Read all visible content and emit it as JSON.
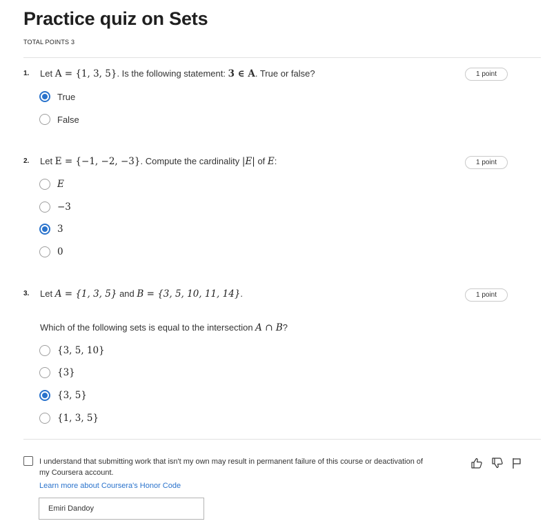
{
  "quiz": {
    "title": "Practice quiz on Sets",
    "total_points": "TOTAL POINTS 3"
  },
  "questions": [
    {
      "number": "1.",
      "points": "1 point",
      "prompt": {
        "t1": "Let ",
        "m1": "A = {1, 3, 5}",
        "t2": ". Is the following statement: ",
        "m2": "3 ∈ A",
        "t3": ". True or false?"
      },
      "options": [
        {
          "label": "True",
          "selected": true
        },
        {
          "label": "False",
          "selected": false
        }
      ]
    },
    {
      "number": "2.",
      "points": "1 point",
      "prompt": {
        "t1": "Let ",
        "m1": "E = {−1, −2, −3}",
        "t2": ". Compute the cardinality ",
        "m2": "|E|",
        "t3": " of ",
        "m3": "E",
        "t4": ":"
      },
      "options": [
        {
          "label": "E",
          "selected": false
        },
        {
          "label": "−3",
          "selected": false
        },
        {
          "label": "3",
          "selected": true
        },
        {
          "label": "0",
          "selected": false
        }
      ]
    },
    {
      "number": "3.",
      "points": "1 point",
      "prompt": {
        "t1": "Let ",
        "m1": "A = {1, 3, 5}",
        "t2": " and ",
        "m2": "B = {3, 5, 10, 11, 14}",
        "t3": "."
      },
      "sub_prompt": {
        "t1": "Which of the following sets is equal to the intersection ",
        "m1": "A ∩ B",
        "t2": "?"
      },
      "options": [
        {
          "label": "{3, 5, 10}",
          "selected": false
        },
        {
          "label": "{3}",
          "selected": false
        },
        {
          "label": "{3, 5}",
          "selected": true
        },
        {
          "label": "{1, 3, 5}",
          "selected": false
        }
      ]
    }
  ],
  "honor_code": {
    "statement": "I understand that submitting work that isn't my own may result in permanent failure of this course or deactivation of my Coursera account.",
    "link": "Learn more about Coursera's Honor Code",
    "name_value": "Emiri Dandoy",
    "checked": false
  },
  "icons": {
    "like": "thumbs-up-icon",
    "dislike": "thumbs-down-icon",
    "report": "flag-icon"
  },
  "colors": {
    "accent": "#2a73cc",
    "text": "#1f1f1f",
    "divider": "#e1e1e1"
  }
}
